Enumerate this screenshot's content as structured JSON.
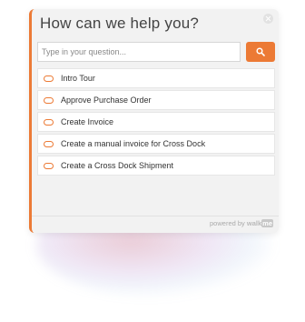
{
  "widget": {
    "title": "How can we help you?",
    "search": {
      "placeholder": "Type in your question...",
      "value": ""
    },
    "items": [
      {
        "label": "Intro Tour"
      },
      {
        "label": "Approve Purchase Order"
      },
      {
        "label": "Create Invoice"
      },
      {
        "label": "Create a manual invoice for Cross Dock"
      },
      {
        "label": "Create a Cross Dock Shipment"
      }
    ],
    "footer": {
      "powered_text": "powered by",
      "brand_walk": "walk",
      "brand_me": "me"
    }
  },
  "icons": {
    "close": "close-icon",
    "search": "search-icon",
    "item": "speech-bubble-icon"
  },
  "colors": {
    "accent": "#ec7a35",
    "panel_bg": "#f2f2f2"
  }
}
